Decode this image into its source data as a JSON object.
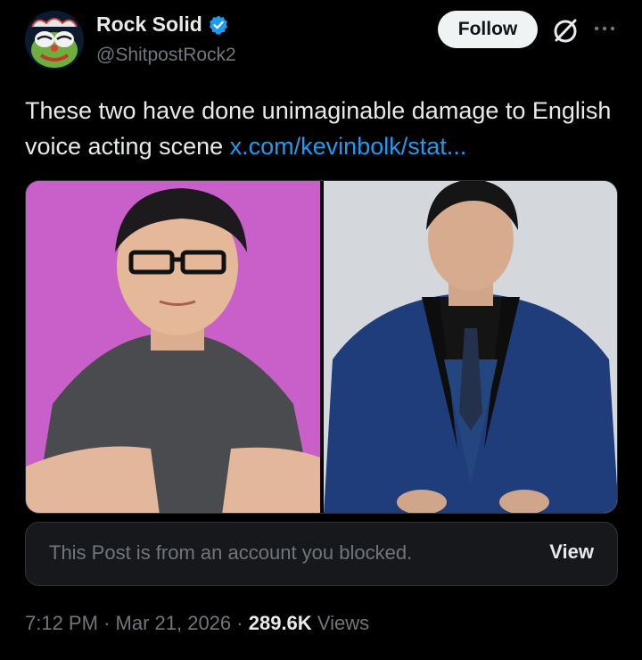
{
  "author": {
    "name": "Rock Solid",
    "handle": "@ShitpostRock2",
    "verified": true,
    "avatar_icon": "clown-pepe-avatar"
  },
  "actions": {
    "follow_label": "Follow",
    "grok_icon": "grok-icon",
    "more_icon": "more-dots-icon"
  },
  "post": {
    "text": "These two have done unimaginable damage to English voice acting scene",
    "link_text": "x.com/kevinbolk/stat..."
  },
  "media": {
    "images": [
      {
        "name": "photo-man-glasses-grey-tshirt",
        "background": "#c95fc8"
      },
      {
        "name": "photo-man-blue-suit",
        "background": "#d4d8dc"
      }
    ]
  },
  "quote": {
    "text": "This Post is from an account you blocked.",
    "view_label": "View"
  },
  "meta": {
    "time": "7:12 PM",
    "date": "Mar 21, 2026",
    "views_count": "289.6K",
    "views_label": "Views",
    "separator": "·"
  },
  "colors": {
    "background": "#000000",
    "text": "#e7e9ea",
    "muted": "#71767b",
    "link": "#1d9bf0",
    "verified_badge": "#1d9bf0"
  }
}
